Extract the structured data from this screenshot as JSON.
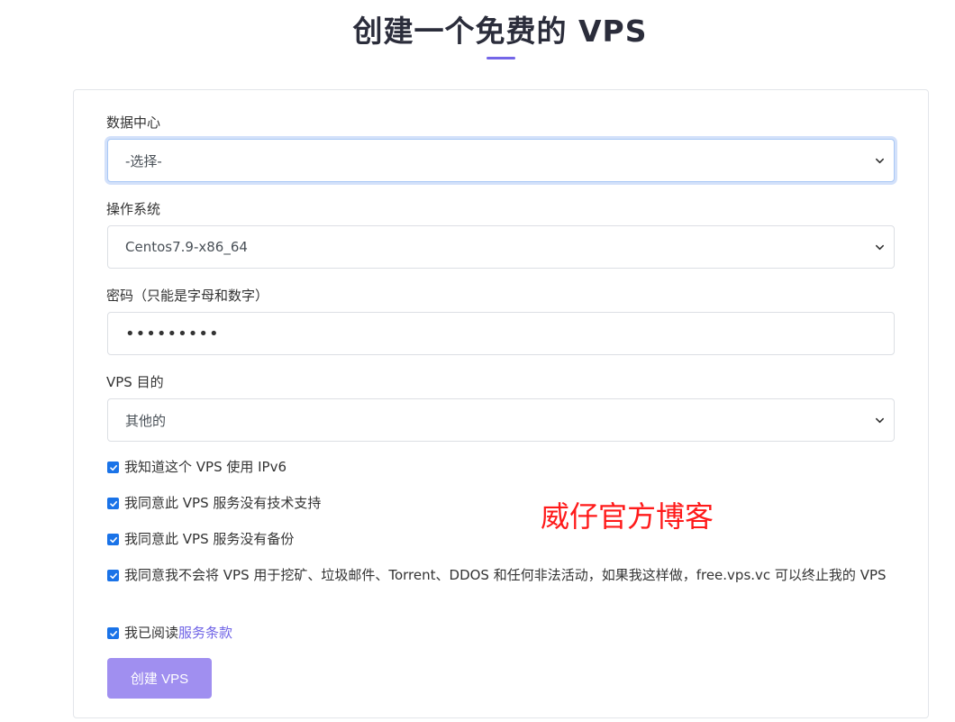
{
  "page": {
    "title": "创建一个免费的 VPS",
    "accent_color": "#7466e8"
  },
  "form": {
    "datacenter": {
      "label": "数据中心",
      "selected": "-选择-"
    },
    "os": {
      "label": "操作系统",
      "selected": "Centos7.9-x86_64"
    },
    "password": {
      "label": "密码（只能是字母和数字）",
      "masked_value": "•••••••••"
    },
    "purpose": {
      "label": "VPS 目的",
      "selected": "其他的"
    },
    "checks": [
      {
        "text": "我知道这个 VPS 使用 IPv6",
        "checked": true
      },
      {
        "text": "我同意此 VPS 服务没有技术支持",
        "checked": true
      },
      {
        "text": "我同意此 VPS 服务没有备份",
        "checked": true
      },
      {
        "text": "我同意我不会将 VPS 用于挖矿、垃圾邮件、Torrent、DDOS 和任何非法活动，如果我这样做，free.vps.vc 可以终止我的 VPS",
        "checked": true
      },
      {
        "text": "我已阅读",
        "link": "服务条款",
        "checked": true
      }
    ],
    "submit_label": "创建 VPS"
  },
  "watermark": {
    "text": "威仔官方博客",
    "color": "#ff1a1a"
  }
}
